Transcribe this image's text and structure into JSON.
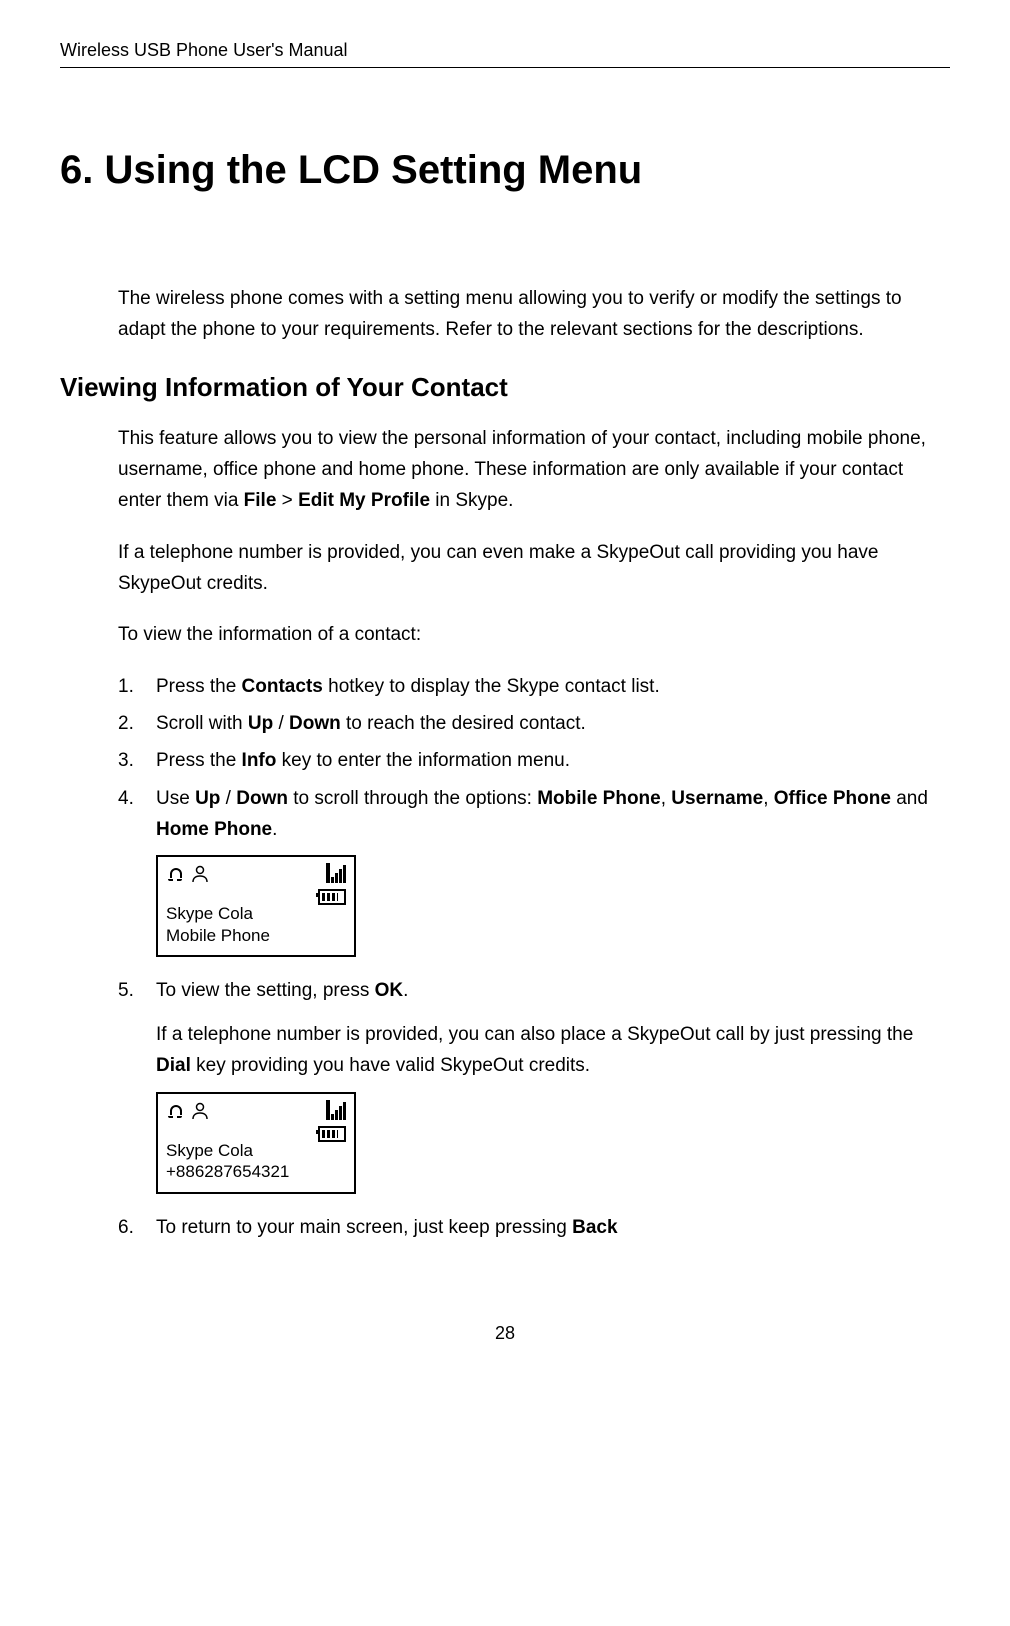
{
  "running_header": "Wireless USB Phone User's Manual",
  "chapter_title": "6. Using the LCD Setting Menu",
  "intro_para": "The wireless phone comes with a setting menu allowing you to verify or modify the settings to adapt the phone to your requirements. Refer to the relevant sections for the descriptions.",
  "section_title": "Viewing Information of Your Contact",
  "section_p1_a": "This feature allows you to view the personal information of your contact, including mobile phone, username, office phone and home phone. These information are only available if your contact enter them via ",
  "section_p1_file": "File",
  "section_p1_gt": " > ",
  "section_p1_edit": "Edit My Profile",
  "section_p1_b": " in Skype.",
  "section_p2": "If a telephone number is provided, you can even make a SkypeOut call providing you have SkypeOut credits.",
  "section_p3": "To view the information of a contact:",
  "steps": {
    "s1_a": "Press the ",
    "s1_b": "Contacts",
    "s1_c": " hotkey to display the Skype contact list.",
    "s2_a": "Scroll with ",
    "s2_b": "Up",
    "s2_slash": " / ",
    "s2_c": "Down",
    "s2_d": " to reach the desired contact.",
    "s3_a": "Press the ",
    "s3_b": "Info",
    "s3_c": " key to enter the information menu.",
    "s4_a": "Use ",
    "s4_b": "Up",
    "s4_slash": " / ",
    "s4_c": "Down",
    "s4_d": " to scroll through the options: ",
    "s4_e": "Mobile Phone",
    "s4_comma1": ", ",
    "s4_f": "Username",
    "s4_comma2": ", ",
    "s4_g": "Office Phone",
    "s4_and": " and ",
    "s4_h": "Home Phone",
    "s4_dot": ".",
    "s5_a": "To view the setting, press ",
    "s5_b": "OK",
    "s5_dot": ".",
    "s5_sub_a": "If a telephone number is provided, you can also place a SkypeOut call by just pressing the ",
    "s5_sub_b": "Dial",
    "s5_sub_c": " key providing you have valid SkypeOut credits.",
    "s6_a": "To return to your main screen, just keep pressing ",
    "s6_b": "Back"
  },
  "screenshot1": {
    "line1": "Skype Cola",
    "line2": "Mobile Phone"
  },
  "screenshot2": {
    "line1": "Skype Cola",
    "line2": "+886287654321"
  },
  "page_number": "28"
}
